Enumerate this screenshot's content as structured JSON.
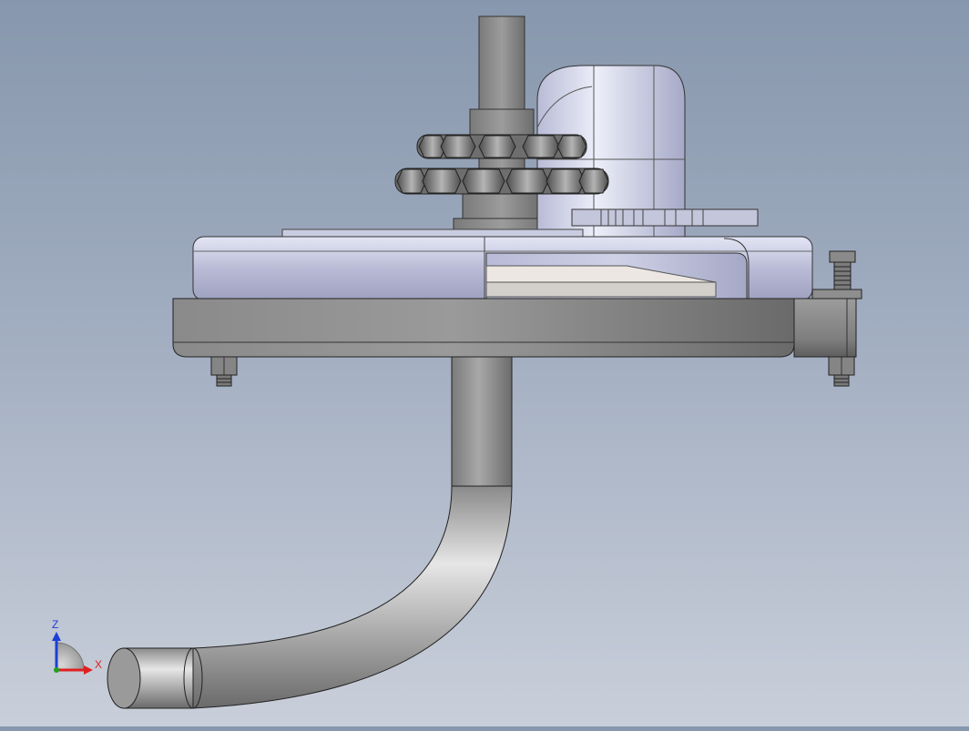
{
  "viewport": {
    "background_top": "#8797ad",
    "background_bottom": "#c9cfda"
  },
  "triad": {
    "z_label": "Z",
    "x_label": "X",
    "z_color": "#1d3fd6",
    "x_color": "#e02020",
    "y_color": "#1fa01f"
  },
  "model": {
    "part_colors": {
      "shaft": "#8c8c8c",
      "housing": "#c7c9dd",
      "base_plate": "#7b7b7b",
      "pipe": "#a8a8a8",
      "sprocket": "#777777",
      "elbow": "#d6d8ec"
    }
  }
}
